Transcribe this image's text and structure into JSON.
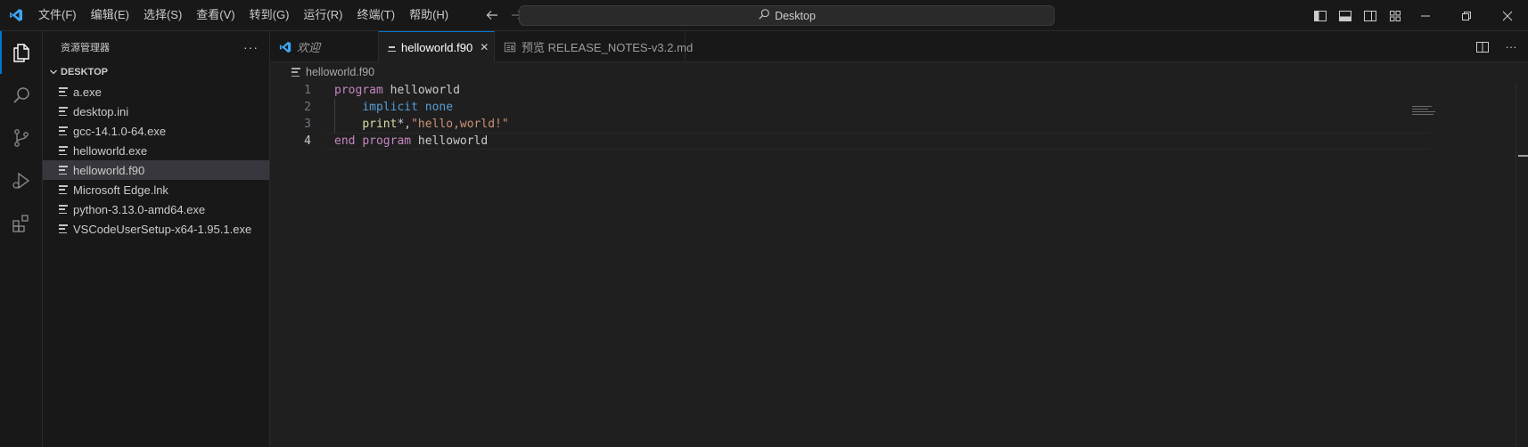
{
  "menu": [
    "文件(F)",
    "编辑(E)",
    "选择(S)",
    "查看(V)",
    "转到(G)",
    "运行(R)",
    "终端(T)",
    "帮助(H)"
  ],
  "command_center": {
    "label": "Desktop"
  },
  "explorer": {
    "title": "资源管理器",
    "more": "···",
    "folder": "DESKTOP",
    "files": [
      "a.exe",
      "desktop.ini",
      "gcc-14.1.0-64.exe",
      "helloworld.exe",
      "helloworld.f90",
      "Microsoft Edge.lnk",
      "python-3.13.0-amd64.exe",
      "VSCodeUserSetup-x64-1.95.1.exe"
    ],
    "selected_file": "helloworld.f90"
  },
  "tabs": [
    {
      "label": "欢迎",
      "icon": "vscode-icon"
    },
    {
      "label": "helloworld.f90",
      "icon": "file-lines-icon",
      "active": true,
      "close": "✕"
    },
    {
      "label": "预览 RELEASE_NOTES-v3.2.md",
      "icon": "preview-icon"
    }
  ],
  "breadcrumb": "helloworld.f90",
  "code": {
    "line_numbers": [
      "1",
      "2",
      "3",
      "4"
    ],
    "current_line": "4",
    "lines": [
      [
        {
          "t": "program",
          "c": "kw"
        },
        {
          "t": " helloworld",
          "c": ""
        }
      ],
      [
        {
          "t": "    ",
          "c": ""
        },
        {
          "t": "implicit",
          "c": "kw2"
        },
        {
          "t": " ",
          "c": ""
        },
        {
          "t": "none",
          "c": "kw2"
        }
      ],
      [
        {
          "t": "    ",
          "c": ""
        },
        {
          "t": "print",
          "c": "fn"
        },
        {
          "t": "*,",
          "c": ""
        },
        {
          "t": "\"hello,world!\"",
          "c": "str"
        }
      ],
      [
        {
          "t": "end",
          "c": "kw"
        },
        {
          "t": " ",
          "c": ""
        },
        {
          "t": "program",
          "c": "kw"
        },
        {
          "t": " helloworld",
          "c": ""
        }
      ]
    ]
  },
  "colors": {
    "accent": "#0078d4",
    "keyword": "#c586c0",
    "keyword_blue": "#569cd6",
    "function": "#dcdcaa",
    "string": "#ce9178"
  }
}
